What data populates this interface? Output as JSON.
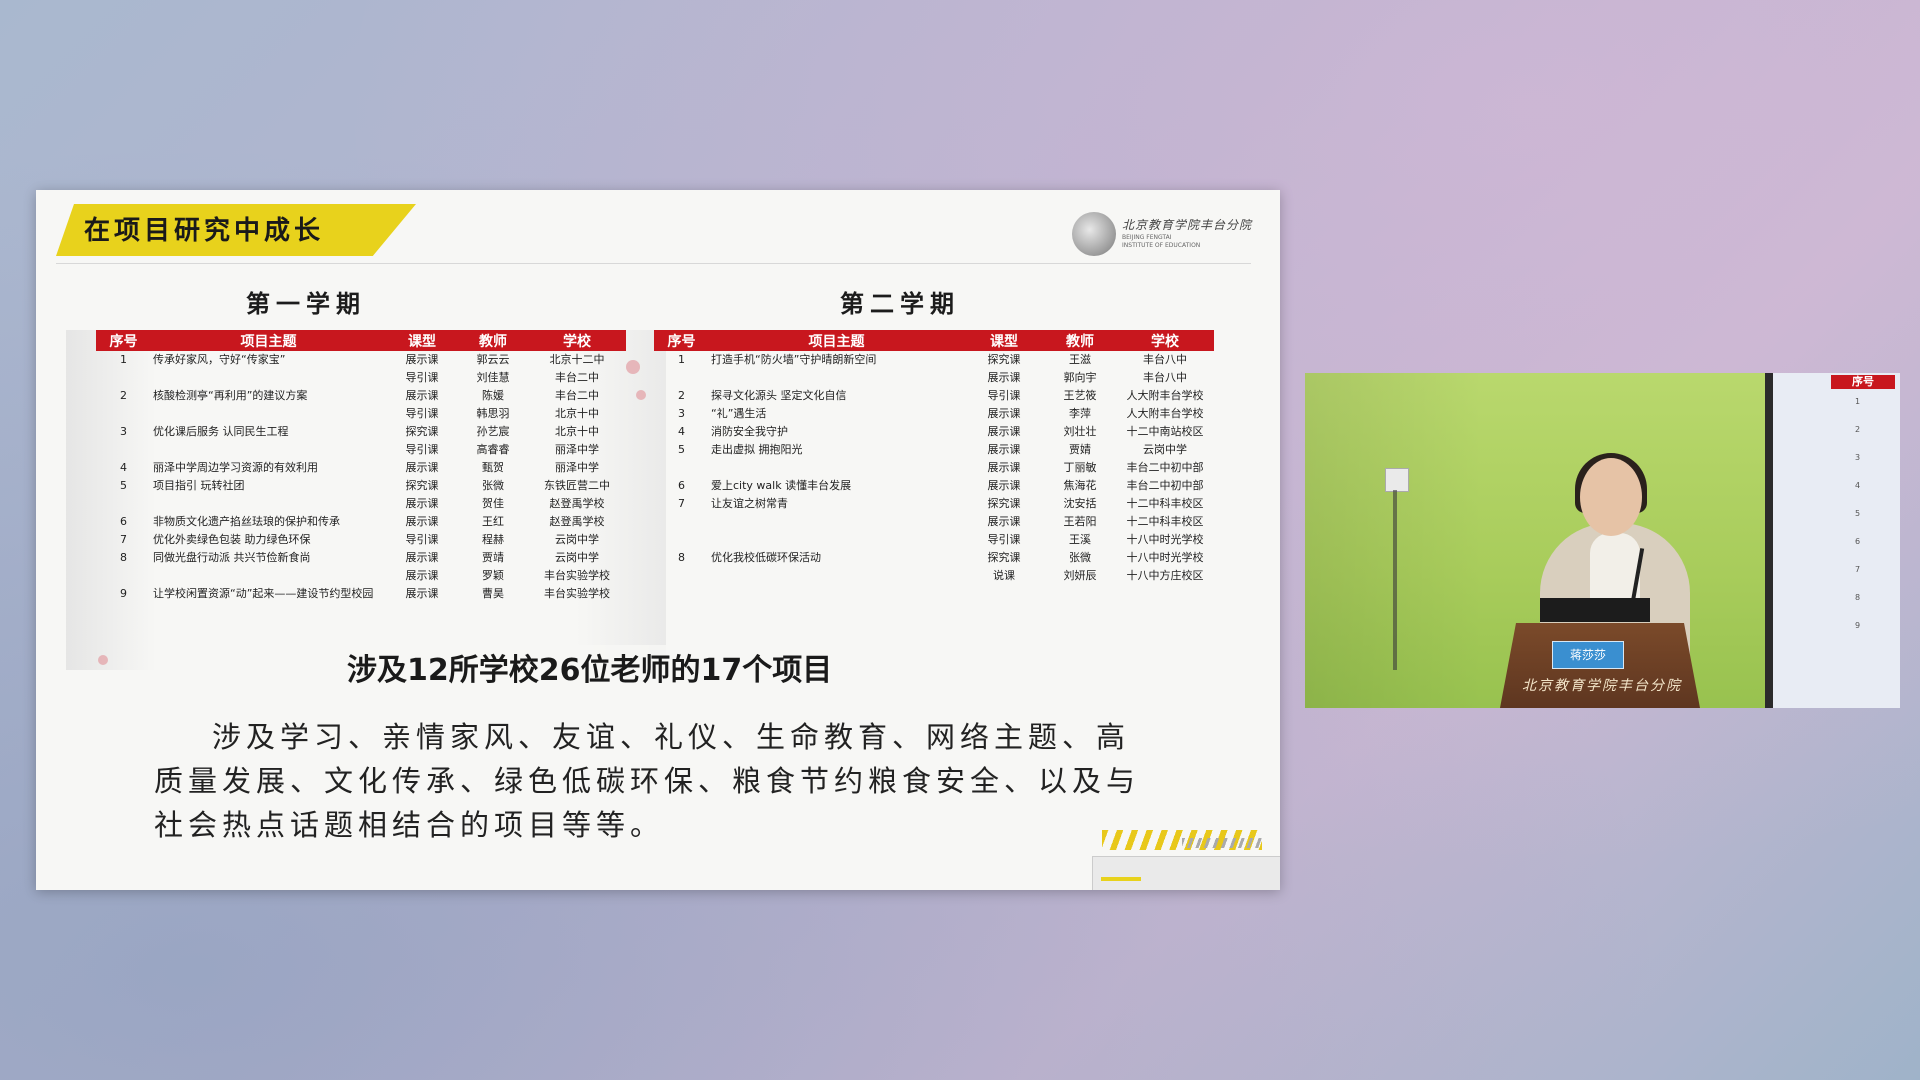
{
  "slide": {
    "title": "在项目研究中成长",
    "logo_cn": "北京教育学院丰台分院",
    "logo_en": "BEIJING FENGTAI INSTITUTE OF EDUCATION",
    "semester1": "第一学期",
    "semester2": "第二学期",
    "headers": [
      "序号",
      "项目主题",
      "课型",
      "教师",
      "学校"
    ],
    "summary": "涉及12所学校26位老师的17个项目",
    "body": "涉及学习、亲情家风、友谊、礼仪、生命教育、网络主题、高质量发展、文化传承、绿色低碳环保、粮食节约粮食安全、以及与社会热点话题相结合的项目等等。"
  },
  "table1": [
    {
      "no": "1",
      "topic": "传承好家风，守好“传家宝”",
      "type": "展示课",
      "teacher": "郭云云",
      "school": "北京十二中"
    },
    {
      "no": "",
      "topic": "",
      "type": "导引课",
      "teacher": "刘佳慧",
      "school": "丰台二中"
    },
    {
      "no": "2",
      "topic": "核酸检测亭“再利用”的建议方案",
      "type": "展示课",
      "teacher": "陈媛",
      "school": "丰台二中"
    },
    {
      "no": "",
      "topic": "",
      "type": "导引课",
      "teacher": "韩思羽",
      "school": "北京十中"
    },
    {
      "no": "3",
      "topic": "优化课后服务 认同民生工程",
      "type": "探究课",
      "teacher": "孙艺宸",
      "school": "北京十中"
    },
    {
      "no": "",
      "topic": "",
      "type": "导引课",
      "teacher": "高睿睿",
      "school": "丽泽中学"
    },
    {
      "no": "4",
      "topic": "丽泽中学周边学习资源的有效利用",
      "type": "展示课",
      "teacher": "甄贺",
      "school": "丽泽中学"
    },
    {
      "no": "5",
      "topic": "项目指引 玩转社团",
      "type": "探究课",
      "teacher": "张微",
      "school": "东铁匠营二中"
    },
    {
      "no": "",
      "topic": "",
      "type": "展示课",
      "teacher": "贺佳",
      "school": "赵登禹学校"
    },
    {
      "no": "6",
      "topic": "非物质文化遗产掐丝珐琅的保护和传承",
      "type": "展示课",
      "teacher": "王红",
      "school": "赵登禹学校"
    },
    {
      "no": "7",
      "topic": "优化外卖绿色包装 助力绿色环保",
      "type": "导引课",
      "teacher": "程赫",
      "school": "云岗中学"
    },
    {
      "no": "8",
      "topic": "同做光盘行动派 共兴节俭新食尚",
      "type": "展示课",
      "teacher": "贾靖",
      "school": "云岗中学"
    },
    {
      "no": "",
      "topic": "",
      "type": "展示课",
      "teacher": "罗颖",
      "school": "丰台实验学校"
    },
    {
      "no": "9",
      "topic": "让学校闲置资源“动”起来——建设节约型校园",
      "type": "展示课",
      "teacher": "曹昊",
      "school": "丰台实验学校"
    }
  ],
  "table2": [
    {
      "no": "1",
      "topic": "打造手机“防火墙”守护晴朗新空间",
      "type": "探究课",
      "teacher": "王滋",
      "school": "丰台八中"
    },
    {
      "no": "",
      "topic": "",
      "type": "展示课",
      "teacher": "郭向宇",
      "school": "丰台八中"
    },
    {
      "no": "2",
      "topic": "探寻文化源头 坚定文化自信",
      "type": "导引课",
      "teacher": "王艺筱",
      "school": "人大附丰台学校"
    },
    {
      "no": "3",
      "topic": "“礼”遇生活",
      "type": "展示课",
      "teacher": "李萍",
      "school": "人大附丰台学校"
    },
    {
      "no": "4",
      "topic": "消防安全我守护",
      "type": "展示课",
      "teacher": "刘壮壮",
      "school": "十二中南站校区"
    },
    {
      "no": "5",
      "topic": "走出虚拟 拥抱阳光",
      "type": "展示课",
      "teacher": "贾婧",
      "school": "云岗中学"
    },
    {
      "no": "",
      "topic": "",
      "type": "展示课",
      "teacher": "丁丽敏",
      "school": "丰台二中初中部"
    },
    {
      "no": "6",
      "topic": "爱上city walk 读懂丰台发展",
      "type": "展示课",
      "teacher": "焦海花",
      "school": "丰台二中初中部"
    },
    {
      "no": "7",
      "topic": "让友谊之树常青",
      "type": "探究课",
      "teacher": "沈安括",
      "school": "十二中科丰校区"
    },
    {
      "no": "",
      "topic": "",
      "type": "展示课",
      "teacher": "王若阳",
      "school": "十二中科丰校区"
    },
    {
      "no": "",
      "topic": "",
      "type": "导引课",
      "teacher": "王溪",
      "school": "十八中时光学校"
    },
    {
      "no": "8",
      "topic": "优化我校低碳环保活动",
      "type": "探究课",
      "teacher": "张微",
      "school": "十八中时光学校"
    },
    {
      "no": "",
      "topic": "",
      "type": "说课",
      "teacher": "刘妍辰",
      "school": "十八中方庄校区"
    }
  ],
  "video": {
    "name_card": "蒋莎莎",
    "podium_text": "北京教育学院丰台分院",
    "screen_header": "序号"
  },
  "colors": {
    "accent_red": "#c8171e",
    "banner_yellow": "#e8d21c",
    "wall_green": "#a8cc5b"
  }
}
